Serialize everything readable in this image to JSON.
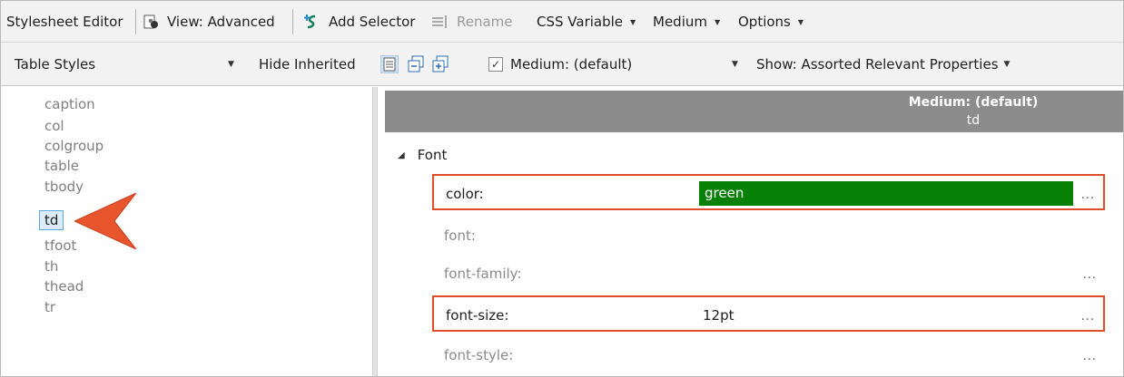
{
  "toolbar1": {
    "title": "Stylesheet Editor",
    "view_label": "View: Advanced",
    "add_selector_label": "Add Selector",
    "rename_label": "Rename",
    "css_variable_label": "CSS Variable",
    "medium_label": "Medium",
    "options_label": "Options"
  },
  "toolbar2": {
    "styles_dropdown": "Table Styles",
    "hide_inherited_label": "Hide Inherited",
    "medium_checkbox_label": "Medium: (default)",
    "show_dropdown": "Show: Assorted Relevant Properties"
  },
  "selectors": [
    "caption",
    "col",
    "colgroup",
    "table",
    "tbody",
    "td",
    "tfoot",
    "th",
    "thead",
    "tr"
  ],
  "selected_selector": "td",
  "properties_header": {
    "medium": "Medium: (default)",
    "selector": "td"
  },
  "group": {
    "label": "Font"
  },
  "properties": [
    {
      "name": "color:",
      "value": "green",
      "value_color": "#068106",
      "highlighted": true
    },
    {
      "name": "font:",
      "value": ""
    },
    {
      "name": "font-family:",
      "value": ""
    },
    {
      "name": "font-size:",
      "value": "12pt",
      "highlighted": true
    },
    {
      "name": "font-style:",
      "value": ""
    }
  ],
  "ellipsis": "...",
  "colors": {
    "callout": "#e04e29",
    "selection": "#dcecf8",
    "header_bg": "#8c8c8c"
  }
}
